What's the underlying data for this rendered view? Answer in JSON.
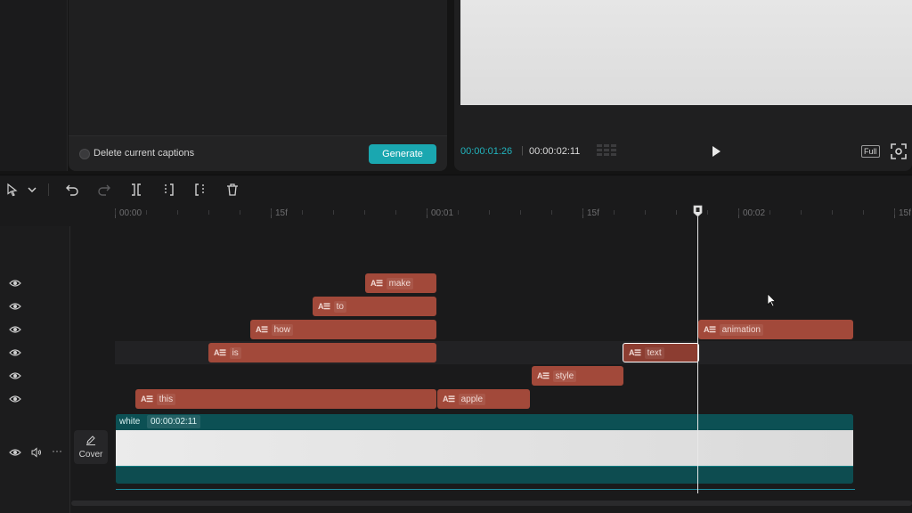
{
  "captions": {
    "checkbox_label": "Delete current captions",
    "generate_label": "Generate"
  },
  "player": {
    "current_time": "00:00:01:26",
    "separator": "|",
    "total_time": "00:00:02:11",
    "full_label": "Full"
  },
  "toolbar": {
    "icons": [
      "select-pointer-icon",
      "dropdown-chevron-icon",
      "undo-icon",
      "redo-icon",
      "split-icon",
      "split-left-icon",
      "split-right-icon",
      "delete-icon"
    ]
  },
  "ruler": {
    "labels": [
      "00:00",
      "15f",
      "00:01",
      "15f",
      "00:02",
      "15f"
    ]
  },
  "text_tracks": [
    {
      "clips": [
        {
          "label": "make",
          "icon": "A☰"
        }
      ]
    },
    {
      "clips": [
        {
          "label": "to",
          "icon": "A☰"
        }
      ]
    },
    {
      "clips": [
        {
          "label": "how",
          "icon": "A☰"
        },
        {
          "label": "animation",
          "icon": "A☰"
        }
      ]
    },
    {
      "clips": [
        {
          "label": "is",
          "icon": "A☰"
        },
        {
          "label": "text",
          "icon": "A☰",
          "selected": true
        }
      ]
    },
    {
      "clips": [
        {
          "label": "style",
          "icon": "A☰"
        }
      ]
    },
    {
      "clips": [
        {
          "label": "this",
          "icon": "A☰"
        },
        {
          "label": "apple",
          "icon": "A☰"
        }
      ]
    }
  ],
  "main_track": {
    "clip_name": "white",
    "clip_duration": "00:00:02:11",
    "cover_label": "Cover",
    "more_label": "···"
  },
  "colors": {
    "accent": "#1aa7b0",
    "text_clip": "#a2493a",
    "video_clip": "#0f5a5d"
  }
}
